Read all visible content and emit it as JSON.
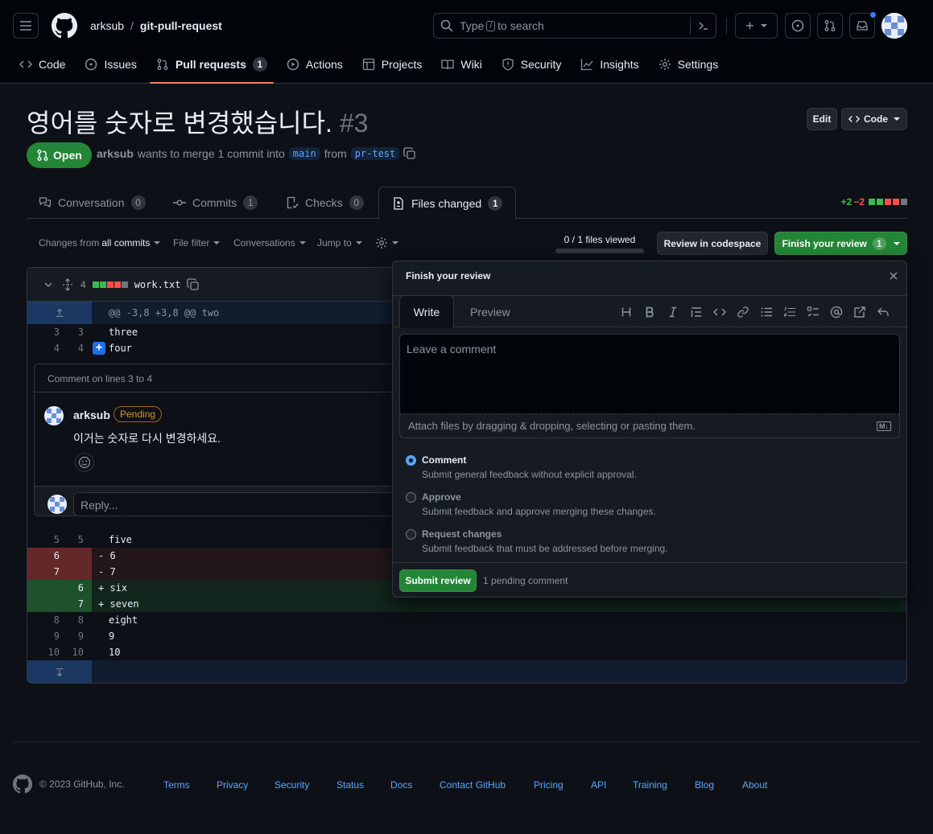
{
  "header": {
    "owner": "arksub",
    "repo": "git-pull-request",
    "search_before": "Type",
    "search_key": "/",
    "search_after": "to search",
    "plus": "+"
  },
  "nav": {
    "code": "Code",
    "issues": "Issues",
    "pulls": "Pull requests",
    "pulls_count": "1",
    "actions": "Actions",
    "projects": "Projects",
    "wiki": "Wiki",
    "security": "Security",
    "insights": "Insights",
    "settings": "Settings"
  },
  "pr": {
    "title": "영어를 숫자로 변경했습니다.",
    "number": "#3",
    "state": "Open",
    "author": "arksub",
    "merge_text": "wants to merge 1 commit into",
    "base": "main",
    "from": "from",
    "head": "pr-test",
    "edit_label": "Edit",
    "code_label": "Code"
  },
  "prtabs": {
    "conversation": "Conversation",
    "conversation_count": "0",
    "commits": "Commits",
    "commits_count": "1",
    "checks": "Checks",
    "checks_count": "0",
    "files": "Files changed",
    "files_count": "1",
    "additions": "+2",
    "deletions": "−2"
  },
  "toolbar": {
    "changes_from": "Changes from",
    "all_commits": "all commits",
    "file_filter": "File filter",
    "conversations": "Conversations",
    "jump_to": "Jump to",
    "files_viewed": "0 / 1 files viewed",
    "codespace": "Review in codespace",
    "finish_review": "Finish your review",
    "finish_count": "1"
  },
  "diff": {
    "changes": "4",
    "filename": "work.txt",
    "hunk_header": "@@ -3,8 +3,8 @@ two",
    "lines": [
      {
        "type": "ctx",
        "old": "3",
        "new": "3",
        "text": "three"
      },
      {
        "type": "ctx",
        "old": "4",
        "new": "4",
        "text": "four"
      },
      {
        "type": "ctx",
        "old": "5",
        "new": "5",
        "text": "five"
      },
      {
        "type": "del",
        "old": "6",
        "new": "",
        "text": "- 6"
      },
      {
        "type": "del",
        "old": "7",
        "new": "",
        "text": "- 7"
      },
      {
        "type": "add",
        "old": "",
        "new": "6",
        "text": "+ six"
      },
      {
        "type": "add",
        "old": "",
        "new": "7",
        "text": "+ seven"
      },
      {
        "type": "ctx",
        "old": "8",
        "new": "8",
        "text": "eight"
      },
      {
        "type": "ctx",
        "old": "9",
        "new": "9",
        "text": "9"
      },
      {
        "type": "ctx",
        "old": "10",
        "new": "10",
        "text": "10"
      }
    ]
  },
  "thread": {
    "header": "Comment on lines 3 to 4",
    "author": "arksub",
    "badge": "Pending",
    "body": "이거는 숫자로 다시 변경하세요.",
    "reply_placeholder": "Reply..."
  },
  "review": {
    "title": "Finish your review",
    "tab_write": "Write",
    "tab_preview": "Preview",
    "placeholder": "Leave a comment",
    "attach": "Attach files by dragging & dropping, selecting or pasting them.",
    "md_badge": "M↓",
    "options": [
      {
        "title": "Comment",
        "desc": "Submit general feedback without explicit approval."
      },
      {
        "title": "Approve",
        "desc": "Submit feedback and approve merging these changes."
      },
      {
        "title": "Request changes",
        "desc": "Submit feedback that must be addressed before merging."
      }
    ],
    "submit": "Submit review",
    "pending": "1 pending comment"
  },
  "footer": {
    "copyright": "© 2023 GitHub, Inc.",
    "links": [
      "Terms",
      "Privacy",
      "Security",
      "Status",
      "Docs",
      "Contact GitHub",
      "Pricing",
      "API",
      "Training",
      "Blog",
      "About"
    ]
  },
  "colors": {
    "accent": "#58a6ff",
    "success": "#238636",
    "danger": "#f85149",
    "attention": "#d29922"
  }
}
